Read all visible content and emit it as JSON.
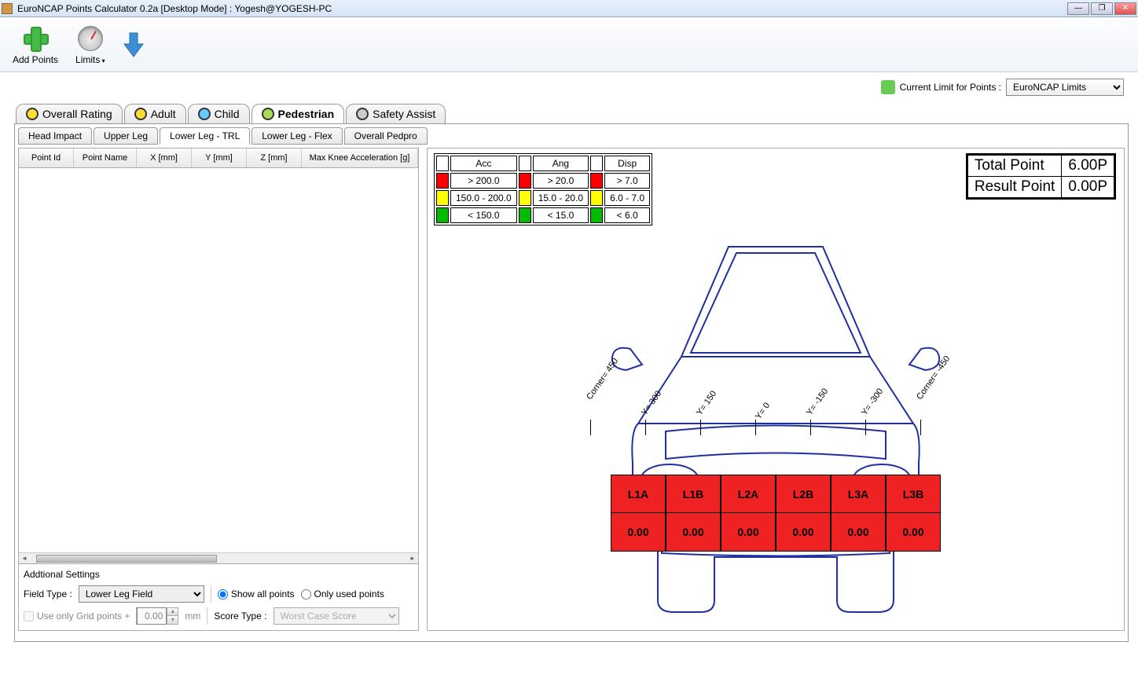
{
  "titlebar": {
    "title": "EuroNCAP Points Calculator 0.2a [Desktop Mode] : Yogesh@YOGESH-PC"
  },
  "toolbar": {
    "add_points": "Add Points",
    "limits": "Limits"
  },
  "limit_bar": {
    "label": "Current Limit for Points :",
    "value": "EuroNCAP Limits"
  },
  "main_tabs": [
    "Overall Rating",
    "Adult",
    "Child",
    "Pedestrian",
    "Safety Assist"
  ],
  "main_tab_active": 3,
  "sub_tabs": [
    "Head Impact",
    "Upper Leg",
    "Lower Leg - TRL",
    "Lower Leg - Flex",
    "Overall Pedpro"
  ],
  "sub_tab_active": 2,
  "grid_headers": [
    "Point Id",
    "Point Name",
    "X [mm]",
    "Y [mm]",
    "Z [mm]",
    "Max Knee Acceleration [g]"
  ],
  "settings": {
    "title": "Addtional Settings",
    "field_type_label": "Field Type  :",
    "field_type_value": "Lower Leg Field",
    "show_all": "Show all points",
    "only_used": "Only used points",
    "grid_points": "Use only Grid points +",
    "grid_value": "0.00",
    "grid_unit": "mm",
    "score_type_label": "Score Type :",
    "score_type_value": "Worst Case Score"
  },
  "legend": {
    "headers": [
      "Acc",
      "Ang",
      "Disp"
    ],
    "rows": [
      {
        "color": "red",
        "acc": "> 200.0",
        "ang": "> 20.0",
        "disp": "> 7.0"
      },
      {
        "color": "yellow",
        "acc": "150.0 - 200.0",
        "ang": "15.0 - 20.0",
        "disp": "6.0 - 7.0"
      },
      {
        "color": "green",
        "acc": "< 150.0",
        "ang": "< 15.0",
        "disp": "< 6.0"
      }
    ]
  },
  "score": {
    "total_label": "Total Point",
    "total_value": "6.00P",
    "result_label": "Result Point",
    "result_value": "0.00P"
  },
  "yticks": [
    "Corner= 450",
    "Y= 300",
    "Y= 150",
    "Y= 0",
    "Y= -150",
    "Y= -300",
    "Corner= -450"
  ],
  "zones": [
    {
      "name": "L1A",
      "val": "0.00"
    },
    {
      "name": "L1B",
      "val": "0.00"
    },
    {
      "name": "L2A",
      "val": "0.00"
    },
    {
      "name": "L2B",
      "val": "0.00"
    },
    {
      "name": "L3A",
      "val": "0.00"
    },
    {
      "name": "L3B",
      "val": "0.00"
    }
  ]
}
